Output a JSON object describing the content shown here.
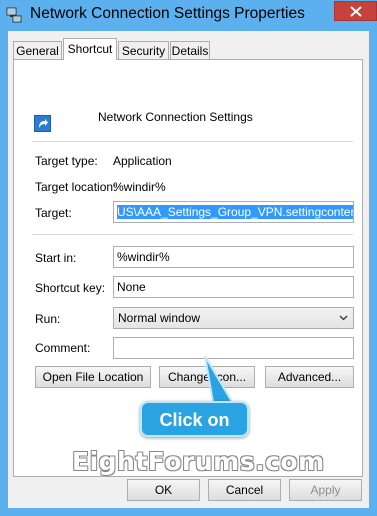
{
  "window": {
    "title": "Network Connection Settings Properties"
  },
  "tabs": [
    {
      "label": "General",
      "active": false
    },
    {
      "label": "Shortcut",
      "active": true
    },
    {
      "label": "Security",
      "active": false
    },
    {
      "label": "Details",
      "active": false
    }
  ],
  "shortcut": {
    "name": "Network Connection Settings",
    "target_type_label": "Target type:",
    "target_type_value": "Application",
    "target_location_label": "Target location:",
    "target_location_value": "%windir%",
    "target_label": "Target:",
    "target_value": "US\\AAA_Settings_Group_VPN.settingcontent-ms",
    "start_in_label": "Start in:",
    "start_in_value": "%windir%",
    "shortcut_key_label": "Shortcut key:",
    "shortcut_key_value": "None",
    "run_label": "Run:",
    "run_value": "Normal window",
    "comment_label": "Comment:",
    "comment_value": ""
  },
  "buttons": {
    "open_file_location": "Open File Location",
    "change_icon": "Change Icon...",
    "advanced": "Advanced...",
    "ok": "OK",
    "cancel": "Cancel",
    "apply": "Apply"
  },
  "annotation": {
    "callout": "Click on",
    "watermark": "EightForums.com"
  },
  "colors": {
    "title_bar": "#5cb0ee",
    "close_button": "#c7423a",
    "selection": "#3399ff",
    "callout": "#2aa3e3"
  },
  "icons": {
    "title": "network-settings-icon",
    "shortcut": "shortcut-arrow-icon",
    "close": "close-icon",
    "dropdown": "chevron-down-icon"
  }
}
